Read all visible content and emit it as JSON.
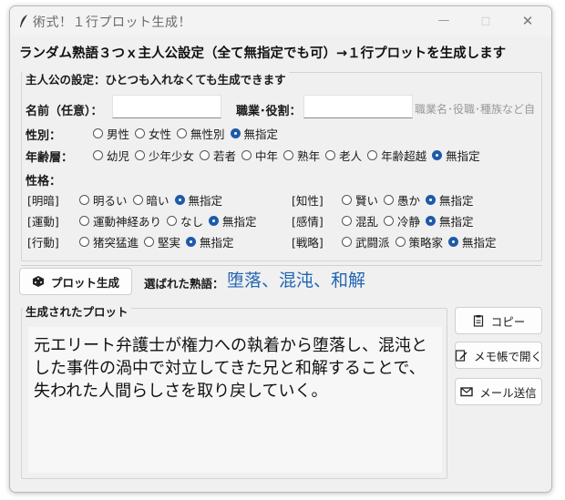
{
  "window": {
    "title": "術式！１行プロット生成！",
    "minimize_glyph": "—",
    "maximize_glyph": "□",
    "close_glyph": "✕"
  },
  "headline": "ランダム熟語３つｘ主人公設定（全て無指定でも可）→１行プロットを生成します",
  "settings": {
    "frame_label": "主人公の設定：ひとつも入れなくても生成できます",
    "name_label": "名前（任意）：",
    "name_value": "",
    "job_label": "職業･役割：",
    "job_value": "",
    "job_hint": "職業名･役職･種族など自",
    "gender": {
      "label": "性別：",
      "options": [
        "男性",
        "女性",
        "無性別",
        "無指定"
      ],
      "selected": 3
    },
    "age": {
      "label": "年齢層：",
      "options": [
        "幼児",
        "少年少女",
        "若者",
        "中年",
        "熟年",
        "老人",
        "年齢超越",
        "無指定"
      ],
      "selected": 7
    },
    "personality_label": "性格：",
    "traits": [
      {
        "category": "[明暗]",
        "options": [
          "明るい",
          "暗い",
          "無指定"
        ],
        "selected": 2
      },
      {
        "category": "[運動]",
        "options": [
          "運動神経あり",
          "なし",
          "無指定"
        ],
        "selected": 2
      },
      {
        "category": "[行動]",
        "options": [
          "猪突猛進",
          "堅実",
          "無指定"
        ],
        "selected": 2
      },
      {
        "category": "[知性]",
        "options": [
          "賢い",
          "愚か",
          "無指定"
        ],
        "selected": 2
      },
      {
        "category": "[感情]",
        "options": [
          "混乱",
          "冷静",
          "無指定"
        ],
        "selected": 2
      },
      {
        "category": "[戦略]",
        "options": [
          "武闘派",
          "策略家",
          "無指定"
        ],
        "selected": 2
      }
    ]
  },
  "actions": {
    "generate_label": "プロット生成",
    "chosen_label": "選ばれた熟語：",
    "chosen_words": "堕落、混沌、和解"
  },
  "output": {
    "frame_label": "生成されたプロット",
    "text": "元エリート弁護士が権力への執着から堕落し、混沌とした事件の渦中で対立してきた兄と和解することで、失われた人間らしさを取り戻していく。"
  },
  "side_buttons": {
    "copy_label": "コピー",
    "memo_label": "メモ帳で開く",
    "mail_label": "メール送信"
  },
  "colors": {
    "accent": "#1e5aa8",
    "chosen_words": "#2266b3"
  }
}
